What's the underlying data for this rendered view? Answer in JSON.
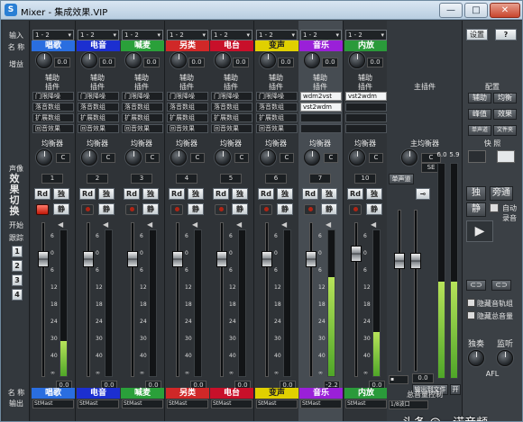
{
  "window": {
    "title": "Mixer - 集成效果.VIP",
    "min": "—",
    "max": "□",
    "close": "✕"
  },
  "left": {
    "input": "输入",
    "name": "名 称",
    "gain": "增益",
    "aux": "辅助",
    "insert": "插件",
    "eq": "均衡器",
    "pan": "声像",
    "fx_switch": "效果切换",
    "start": "开始",
    "follow": "跟踪",
    "nums": [
      "1",
      "2",
      "3",
      "4"
    ],
    "output": "输出"
  },
  "colors": {
    "唱歌": "#2a6ee0",
    "电音": "#1c2fd0",
    "喊麦": "#2aa03a",
    "另类": "#d02828",
    "电台": "#c8102a",
    "变声": "#e0d000",
    "音乐": "#9a20d8",
    "内放": "#2a9a3a"
  },
  "channels": [
    {
      "name": "唱歌",
      "color": "#2a6ee0",
      "input": "1 - 2",
      "gain": "0.0",
      "ins": [
        "门限降噪",
        "落音数组",
        "扩展数组",
        "回音效果"
      ],
      "pan": "C",
      "num": "1",
      "vol": "0.0",
      "out": "StMast",
      "meter": 0.24
    },
    {
      "name": "电音",
      "color": "#1c2fd0",
      "input": "1 - 2",
      "gain": "0.0",
      "ins": [
        "门限降噪",
        "落音数组",
        "扩展数组",
        "回音效果"
      ],
      "pan": "C",
      "num": "2",
      "vol": "0.0",
      "out": "StMast",
      "meter": 0
    },
    {
      "name": "喊麦",
      "color": "#2aa03a",
      "input": "1 - 2",
      "gain": "0.0",
      "ins": [
        "门限降噪",
        "落音数组",
        "扩展数组",
        "回音效果"
      ],
      "pan": "C",
      "num": "3",
      "vol": "0.0",
      "out": "StMast",
      "meter": 0
    },
    {
      "name": "另类",
      "color": "#d02828",
      "input": "1 - 2",
      "gain": "0.0",
      "ins": [
        "门限降噪",
        "落音数组",
        "扩展数组",
        "回音效果"
      ],
      "pan": "C",
      "num": "4",
      "vol": "0.0",
      "out": "StMast",
      "meter": 0
    },
    {
      "name": "电台",
      "color": "#c8102a",
      "input": "1 - 2",
      "gain": "0.0",
      "ins": [
        "门限降噪",
        "落音数组",
        "扩展数组",
        "回音效果"
      ],
      "pan": "C",
      "num": "5",
      "vol": "0.0",
      "out": "StMast",
      "meter": 0
    },
    {
      "name": "变声",
      "color": "#e0d000",
      "input": "1 - 2",
      "gain": "0.0",
      "ins": [
        "门限降噪",
        "落音数组",
        "扩展数组",
        "回音效果"
      ],
      "pan": "C",
      "num": "6",
      "vol": "0.0",
      "out": "StMast",
      "meter": 0
    },
    {
      "name": "音乐",
      "color": "#9a20d8",
      "input": "1 - 2",
      "gain": "0.0",
      "ins": [
        "wdm2vst",
        "vst2wdm",
        "",
        ""
      ],
      "pan": "C",
      "num": "7",
      "vol": "-2.2",
      "out": "StMast",
      "meter": 0.68
    },
    {
      "name": "内放",
      "color": "#2a9a3a",
      "input": "1 - 2",
      "gain": "0.0",
      "ins": [
        "vst2wdm",
        "",
        "",
        ""
      ],
      "pan": "C",
      "num": "10",
      "vol": "0.0",
      "out": "StMast",
      "meter": 0.3
    }
  ],
  "strip_labels": {
    "rd": "Rd",
    "solo": "独",
    "mute": "静"
  },
  "master": {
    "insert": "主插件",
    "eq": "主均衡器",
    "pan": "C",
    "se": "SE",
    "dist": "单声道",
    "meter_top": [
      "6.0",
      "5.9"
    ],
    "vol": "0.0",
    "out": "输出到文件",
    "solo": "开",
    "label": "总音量控制",
    "bottom": "1/8波口"
  },
  "right": {
    "setup": "设置",
    "help": "?",
    "config": "配置",
    "buttons": [
      [
        "辅助",
        "均衡"
      ],
      [
        "峰值",
        "效果"
      ],
      [
        "单声道",
        "文件夹"
      ]
    ],
    "quick": "快 照",
    "solo": "独",
    "bypass": "旁通",
    "mute": "静",
    "auto": "自动",
    "record": "录音",
    "hide_track": "隐藏音轨组",
    "hide_master": "隐藏总音量",
    "solo_lbl": "独奏",
    "monitor": "监听",
    "afl": "AFL"
  },
  "scale": [
    "6",
    "0",
    "6",
    "12",
    "18",
    "24",
    "30",
    "40",
    "∞"
  ],
  "watermark": "头条 @一诺音频"
}
